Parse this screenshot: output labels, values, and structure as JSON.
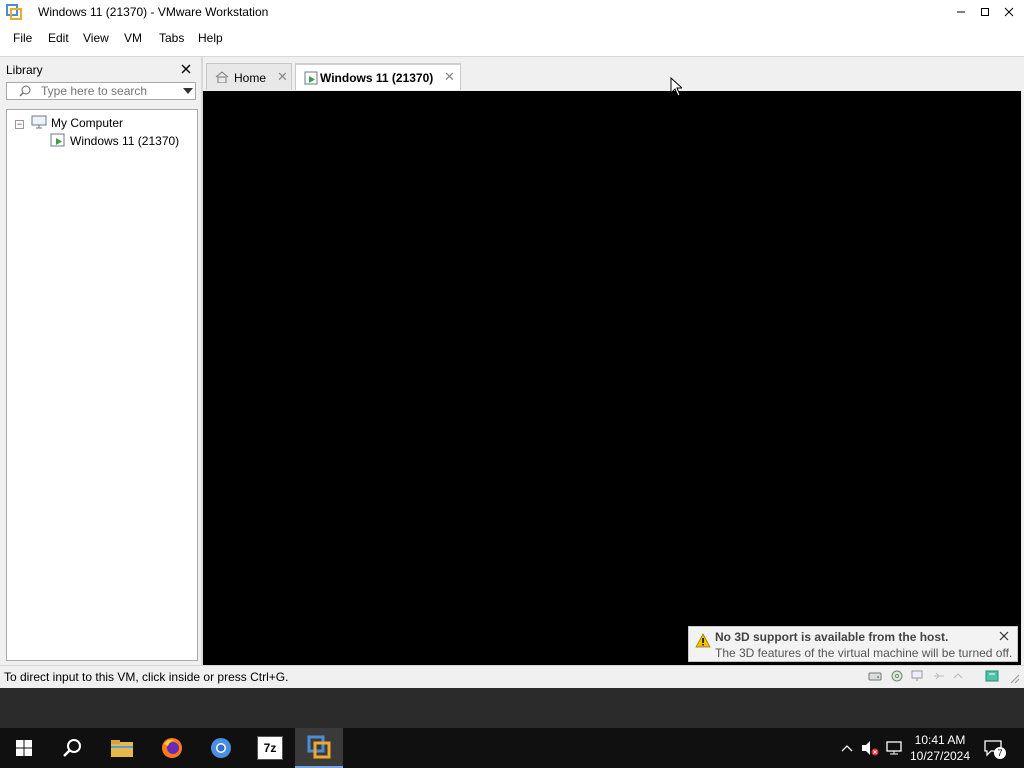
{
  "window": {
    "title": "Windows 11 (21370) - VMware Workstation",
    "controls": {
      "minimize": "minimize-icon",
      "maximize": "maximize-icon",
      "close": "close-icon"
    }
  },
  "menu": {
    "items": [
      "File",
      "Edit",
      "View",
      "VM",
      "Tabs",
      "Help"
    ]
  },
  "library": {
    "title": "Library",
    "search_placeholder": "Type here to search",
    "tree": {
      "root_label": "My Computer",
      "vm_label": "Windows 11 (21370)"
    }
  },
  "tabs": [
    {
      "label": "Home",
      "icon": "home-icon",
      "active": false
    },
    {
      "label": "Windows 11 (21370)",
      "icon": "vm-running-icon",
      "active": true
    }
  ],
  "notification": {
    "title": "No 3D support is available from the host.",
    "text": "The 3D features of the virtual machine will be turned off."
  },
  "status": {
    "text": "To direct input to this VM, click inside or press Ctrl+G."
  },
  "taskbar": {
    "apps": [
      "start-icon",
      "search-icon",
      "file-explorer-icon",
      "firefox-icon",
      "chrome-icon",
      "7zip-icon",
      "vmware-icon"
    ],
    "seven_zip_label": "7z",
    "clock_time": "10:41 AM",
    "clock_date": "10/27/2024",
    "notification_count": "7"
  },
  "colors": {
    "vm_screen": "#000000",
    "taskbar": "#101010",
    "accent": "#7aa7e0"
  }
}
